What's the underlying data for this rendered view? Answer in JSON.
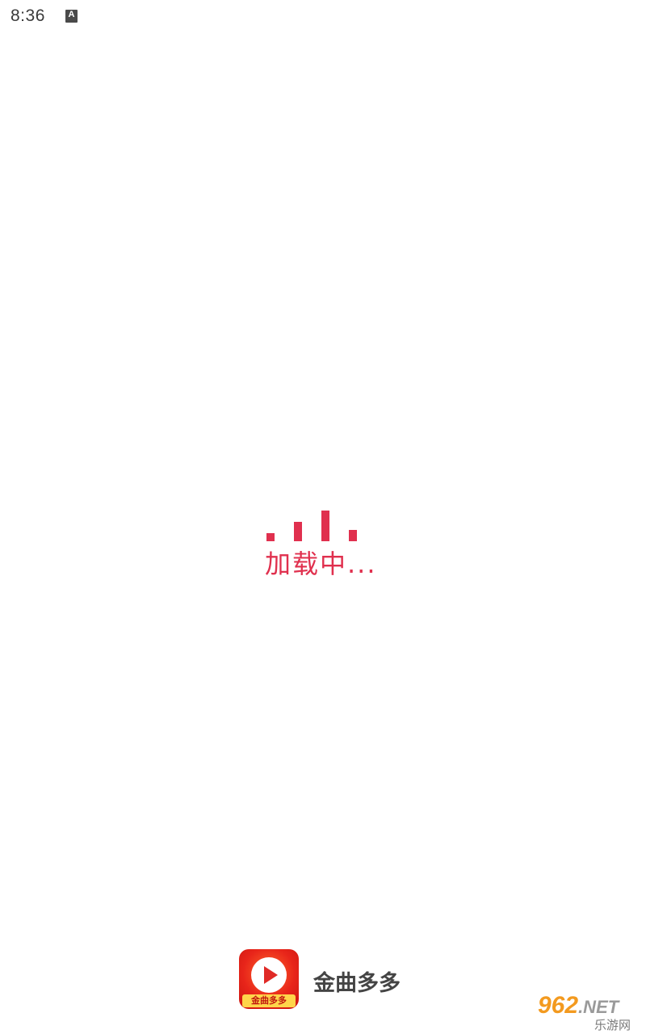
{
  "status_bar": {
    "time": "8:36",
    "notification_icon": "a-letter-icon",
    "notification_glyph": "A"
  },
  "loader": {
    "text": "加载中...",
    "color": "#e0304e",
    "bars_icon": "equalizer-bars-icon"
  },
  "brand": {
    "logo_icon": "play-button-logo-icon",
    "logo_caption": "金曲多多",
    "name": "金曲多多",
    "logo_color": "#e8251a"
  },
  "watermark": {
    "main": "962",
    "suffix": ".NET",
    "sub": "乐游网"
  }
}
